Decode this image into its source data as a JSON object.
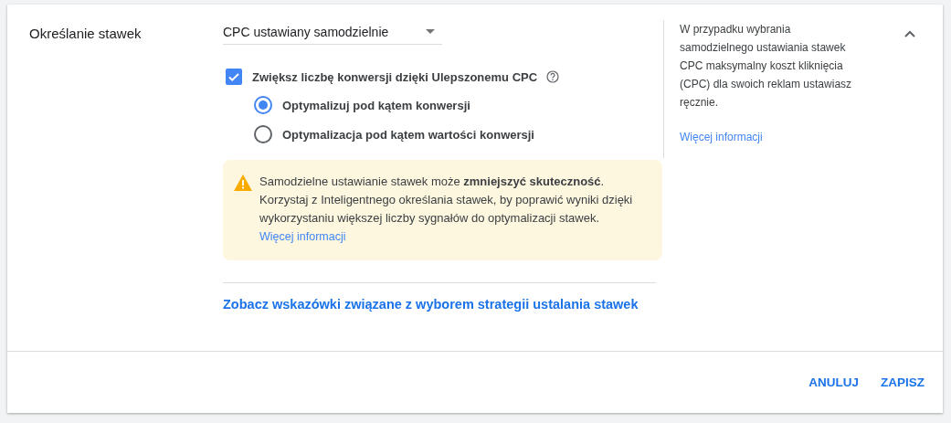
{
  "section": {
    "title": "Określanie stawek"
  },
  "bidding_dropdown": {
    "value": "CPC ustawiany samodzielnie"
  },
  "enhanced_cpc": {
    "label": "Zwiększ liczbę konwersji dzięki Ulepszonemu CPC",
    "checked": true
  },
  "optimization_options": [
    {
      "label": "Optymalizuj pod kątem konwersji",
      "selected": true
    },
    {
      "label": "Optymalizacja pod kątem wartości konwersji",
      "selected": false
    }
  ],
  "warning": {
    "text": "Samodzielne ustawianie stawek może **zmniejszyć skuteczność**. Korzystaj z Inteligentnego określania stawek, by poprawić wyniki dzięki wykorzystaniu większej liczby sygnałów do optymalizacji stawek.",
    "link": "Więcej informacji"
  },
  "tips_link": "Zobacz wskazówki związane z wyborem strategii ustalania stawek",
  "help_panel": {
    "text": "W przypadku wybrania samodzielnego ustawiania stawek CPC maksymalny koszt kliknięcia (CPC) dla swoich reklam ustawiasz ręcznie.",
    "link": "Więcej informacji",
    "expanded": true
  },
  "buttons": [
    {
      "label": "ANULUJ"
    },
    {
      "label": "ZAPISZ"
    }
  ]
}
